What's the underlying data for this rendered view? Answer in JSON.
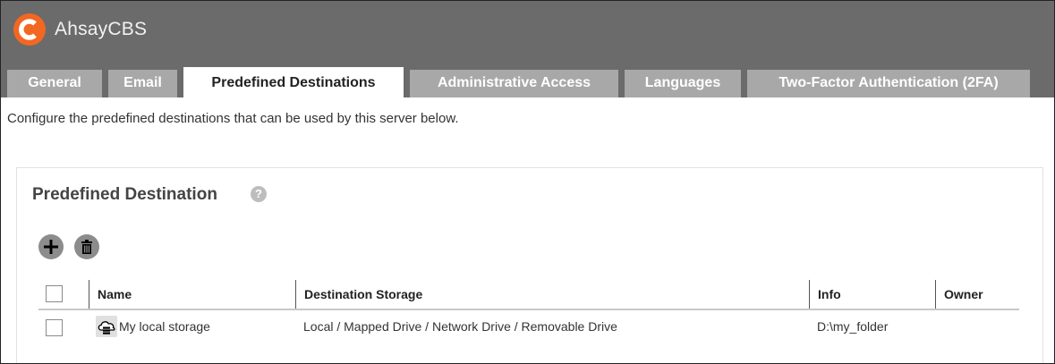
{
  "app": {
    "title": "AhsayCBS",
    "logo_icon": "ahsay-c-logo",
    "brand_color": "#f26722"
  },
  "tabs": [
    {
      "label": "General",
      "active": false
    },
    {
      "label": "Email",
      "active": false
    },
    {
      "label": "Predefined Destinations",
      "active": true
    },
    {
      "label": "Administrative Access",
      "active": false
    },
    {
      "label": "Languages",
      "active": false
    },
    {
      "label": "Two-Factor Authentication (2FA)",
      "active": false
    }
  ],
  "description": "Configure the predefined destinations that can be used by this server below.",
  "panel": {
    "title": "Predefined Destination",
    "help_icon": "question-circle-icon",
    "actions": [
      {
        "icon": "plus-icon"
      },
      {
        "icon": "trash-icon"
      }
    ]
  },
  "table": {
    "columns": [
      "Name",
      "Destination Storage",
      "Info",
      "Owner"
    ],
    "rows": [
      {
        "checked": false,
        "icon": "cloud-storage-icon",
        "name": "My local storage",
        "destination_storage": "Local / Mapped Drive / Network Drive / Removable Drive",
        "info": "D:\\my_folder",
        "owner": ""
      }
    ]
  }
}
